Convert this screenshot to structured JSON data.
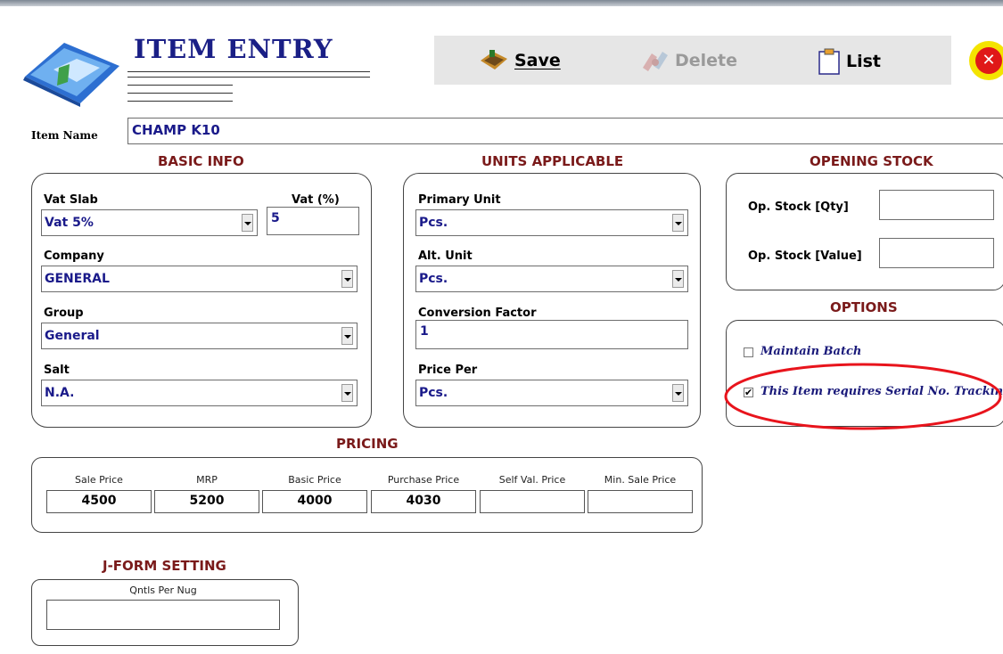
{
  "header": {
    "title": "ITEM ENTRY",
    "save_label": "Save",
    "delete_label": "Delete",
    "list_label": "List",
    "close_symbol": "✕"
  },
  "item_name": {
    "label": "Item Name",
    "value": "CHAMP K10"
  },
  "basic_info": {
    "title": "BASIC INFO",
    "vat_slab_label": "Vat Slab",
    "vat_slab_value": "Vat 5%",
    "vat_pct_label": "Vat (%)",
    "vat_pct_value": "5",
    "company_label": "Company",
    "company_value": "GENERAL",
    "group_label": "Group",
    "group_value": "General",
    "salt_label": "Salt",
    "salt_value": "N.A."
  },
  "units": {
    "title": "UNITS APPLICABLE",
    "primary_label": "Primary Unit",
    "primary_value": "Pcs.",
    "alt_label": "Alt. Unit",
    "alt_value": "Pcs.",
    "conv_label": "Conversion Factor",
    "conv_value": "1",
    "price_per_label": "Price Per",
    "price_per_value": "Pcs."
  },
  "opening_stock": {
    "title": "OPENING STOCK",
    "qty_label": "Op. Stock [Qty]",
    "qty_value": "",
    "value_label": "Op. Stock [Value]",
    "value_value": ""
  },
  "options": {
    "title": "OPTIONS",
    "maintain_batch_label": "Maintain Batch",
    "maintain_batch_checked": false,
    "serial_label": "This Item requires Serial No. Tracking",
    "serial_checked": true,
    "check_mark": "✔"
  },
  "pricing": {
    "title": "PRICING",
    "columns": [
      {
        "label": "Sale Price",
        "value": "4500"
      },
      {
        "label": "MRP",
        "value": "5200"
      },
      {
        "label": "Basic Price",
        "value": "4000"
      },
      {
        "label": "Purchase Price",
        "value": "4030"
      },
      {
        "label": "Self Val. Price",
        "value": ""
      },
      {
        "label": "Min. Sale Price",
        "value": ""
      }
    ]
  },
  "jform": {
    "title": "J-FORM SETTING",
    "qntls_label": "Qntls Per Nug",
    "qntls_value": ""
  },
  "colors": {
    "title_blue": "#1a1f86",
    "section_red": "#7a1a1a",
    "value_blue": "#1a1a8a",
    "highlight_ellipse": "#e8141c"
  }
}
